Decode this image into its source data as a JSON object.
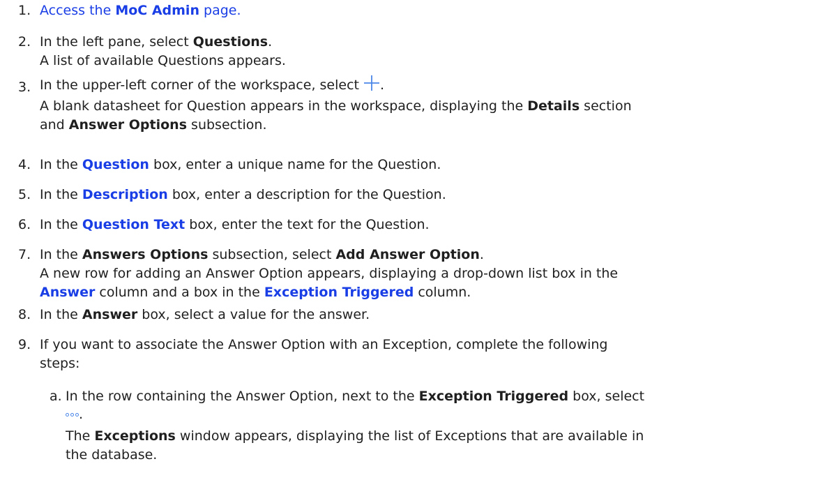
{
  "steps": [
    {
      "num": "1.",
      "pre": "Access the ",
      "bold": "MoC Admin",
      "post": " page."
    },
    {
      "num": "2.",
      "pre": "In the left pane, select ",
      "bold": "Questions",
      "post": ".",
      "line2": "A list of available Questions appears."
    },
    {
      "num": "3.",
      "pre": "In the upper-left corner of the workspace, select ",
      "post": ".",
      "line2": "A blank datasheet for Question appears in the workspace, displaying the ",
      "line2_bold": "Details",
      "line2_post": " section",
      "line3_bold": "Answer Options",
      "line3_pre": "and ",
      "line3_post": " subsection."
    },
    {
      "num": "4.",
      "pre": "In the ",
      "bold": "Question",
      "post": " box, enter a unique name for the Question."
    },
    {
      "num": "5.",
      "pre": "In the ",
      "bold": "Description",
      "post": " box, enter a description for the Question."
    },
    {
      "num": "6.",
      "pre": "In the ",
      "bold": "Question Text",
      "post": " box, enter the text for the Question."
    },
    {
      "num": "7.",
      "pre": "In the ",
      "bold": "Answers Options",
      "mid": " subsection, select ",
      "bold2": "Add Answer Option",
      "post": ".",
      "line2": "A new row for adding an Answer Option appears, displaying a drop-down list box in the",
      "line3_bold": "Answer",
      "line3_mid": " column and a box in the ",
      "line3_bold2": "Exception Triggered",
      "line3_post": " column."
    },
    {
      "num": "8.",
      "pre": "In the ",
      "bold": "Answer",
      "post": " box, select a value for the answer."
    },
    {
      "num": "9.",
      "line1": "If you want to associate the Answer Option with an Exception, complete the following",
      "line2": "steps:"
    }
  ],
  "substep": {
    "num": "a.",
    "pre": "In the row containing the Answer Option, next to the ",
    "bold": "Exception Triggered",
    "post": " box, select",
    "after_icon": ".",
    "line3_pre": "The ",
    "line3_bold": "Exceptions",
    "line3_post": " window appears, displaying the list of Exceptions that are available in",
    "line4": "the database."
  },
  "icons": {
    "add": "plus-icon",
    "more": "more-options-icon",
    "accent": "#4a86e8",
    "link": "#1a3ee6"
  }
}
